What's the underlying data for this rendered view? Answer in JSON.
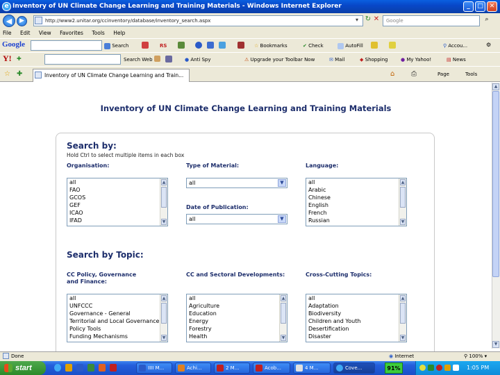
{
  "window": {
    "title": "Inventory of UN Climate Change Learning and Training Materials - Windows Internet Explorer",
    "minimize": "_",
    "maximize": "□",
    "close": "✕"
  },
  "address_bar": {
    "url": "http://www2.unitar.org/ccinventory/database/inventory_search.aspx",
    "search_placeholder": "Google"
  },
  "menu": [
    "File",
    "Edit",
    "View",
    "Favorites",
    "Tools",
    "Help"
  ],
  "google_toolbar": {
    "logo": "Google",
    "items": [
      "Search",
      "RS",
      "Bookmarks",
      "Check",
      "AutoFill",
      "Accou..."
    ]
  },
  "yahoo_toolbar": {
    "logo": "Y!",
    "items": [
      "Search Web",
      "Anti Spy",
      "Upgrade your Toolbar Now",
      "Mail",
      "Shopping",
      "My Yahoo!",
      "News"
    ]
  },
  "tab": {
    "label": "Inventory of UN Climate Change Learning and Train...",
    "tools": [
      "Page",
      "Tools"
    ]
  },
  "page": {
    "title": "Inventory of UN Climate Change Learning and Training Materials",
    "search_by": {
      "heading": "Search by:",
      "hint": "Hold Ctrl to select multiple items in each box",
      "organisation": {
        "label": "Organisation:",
        "options": [
          "all",
          "FAO",
          "GCOS",
          "GEF",
          "ICAO",
          "IFAD"
        ]
      },
      "type_of_material": {
        "label": "Type of Material:",
        "value": "all"
      },
      "date_of_publication": {
        "label": "Date of Publication:",
        "value": "all"
      },
      "language": {
        "label": "Language:",
        "options": [
          "all",
          "Arabic",
          "Chinese",
          "English",
          "French",
          "Russian"
        ]
      }
    },
    "search_by_topic": {
      "heading": "Search by Topic:",
      "cc_policy": {
        "label_line1": "CC Policy, Governance",
        "label_line2": "and Finance:",
        "options": [
          "all",
          "UNFCCC",
          "Governance - General",
          "Territorial and Local Governance",
          "Policy Tools",
          "Funding Mechanisms"
        ]
      },
      "cc_sectoral": {
        "label": "CC and Sectoral Developments:",
        "options": [
          "all",
          "Agriculture",
          "Education",
          "Energy",
          "Forestry",
          "Health"
        ]
      },
      "cross_cutting": {
        "label": "Cross-Cutting Topics:",
        "options": [
          "all",
          "Adaptation",
          "Biodiversity",
          "Children and Youth",
          "Desertification",
          "Disaster"
        ]
      }
    }
  },
  "status_bar": {
    "left": "Done",
    "zone": "Internet",
    "zoom": "100%"
  },
  "taskbar": {
    "start": "start",
    "tasks": [
      "IIII M...",
      "Achi...",
      "2 M...",
      "Acob...",
      "4 M...",
      "Cove..."
    ],
    "battery": "91%",
    "clock": "1:05 PM"
  }
}
